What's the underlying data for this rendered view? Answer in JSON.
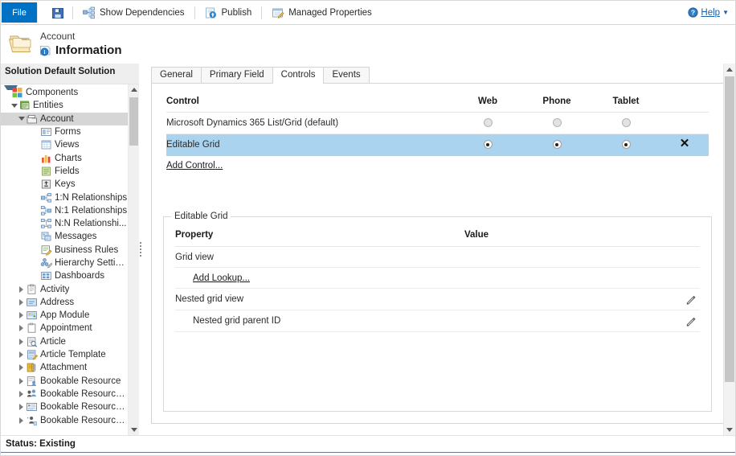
{
  "ribbon": {
    "file_label": "File",
    "save_icon": "save-icon",
    "items": [
      {
        "label": "Show Dependencies",
        "icon": "dependencies-icon"
      },
      {
        "label": "Publish",
        "icon": "publish-icon"
      },
      {
        "label": "Managed Properties",
        "icon": "managed-properties-icon"
      }
    ],
    "help_label": "Help",
    "help_icon": "help-icon"
  },
  "header": {
    "entity_label": "Account",
    "page_title": "Information",
    "folder_icon": "folder-icon",
    "info_icon": "information-icon"
  },
  "sidebar": {
    "solution_header": "Solution Default Solution",
    "tree": [
      {
        "label": "Components",
        "depth": 0,
        "arrow": "none",
        "icon": "components-icon",
        "selected": false
      },
      {
        "label": "Entities",
        "depth": 1,
        "arrow": "expanded",
        "icon": "entities-icon",
        "selected": false
      },
      {
        "label": "Account",
        "depth": 2,
        "arrow": "expanded",
        "icon": "entity-icon",
        "selected": true
      },
      {
        "label": "Forms",
        "depth": 4,
        "arrow": "none",
        "icon": "forms-icon",
        "selected": false
      },
      {
        "label": "Views",
        "depth": 4,
        "arrow": "none",
        "icon": "views-icon",
        "selected": false
      },
      {
        "label": "Charts",
        "depth": 4,
        "arrow": "none",
        "icon": "charts-icon",
        "selected": false
      },
      {
        "label": "Fields",
        "depth": 4,
        "arrow": "none",
        "icon": "fields-icon",
        "selected": false
      },
      {
        "label": "Keys",
        "depth": 4,
        "arrow": "none",
        "icon": "keys-icon",
        "selected": false
      },
      {
        "label": "1:N Relationships",
        "depth": 4,
        "arrow": "none",
        "icon": "one-to-many-icon",
        "selected": false
      },
      {
        "label": "N:1 Relationships",
        "depth": 4,
        "arrow": "none",
        "icon": "many-to-one-icon",
        "selected": false
      },
      {
        "label": "N:N Relationshi...",
        "depth": 4,
        "arrow": "none",
        "icon": "many-to-many-icon",
        "selected": false
      },
      {
        "label": "Messages",
        "depth": 4,
        "arrow": "none",
        "icon": "messages-icon",
        "selected": false
      },
      {
        "label": "Business Rules",
        "depth": 4,
        "arrow": "none",
        "icon": "business-rules-icon",
        "selected": false
      },
      {
        "label": "Hierarchy Settin...",
        "depth": 4,
        "arrow": "none",
        "icon": "hierarchy-settings-icon",
        "selected": false
      },
      {
        "label": "Dashboards",
        "depth": 4,
        "arrow": "none",
        "icon": "dashboards-icon",
        "selected": false
      },
      {
        "label": "Activity",
        "depth": 2,
        "arrow": "collapsed",
        "icon": "activity-icon",
        "selected": false
      },
      {
        "label": "Address",
        "depth": 2,
        "arrow": "collapsed",
        "icon": "address-icon",
        "selected": false
      },
      {
        "label": "App Module",
        "depth": 2,
        "arrow": "collapsed",
        "icon": "app-module-icon",
        "selected": false
      },
      {
        "label": "Appointment",
        "depth": 2,
        "arrow": "collapsed",
        "icon": "appointment-icon",
        "selected": false
      },
      {
        "label": "Article",
        "depth": 2,
        "arrow": "collapsed",
        "icon": "article-icon",
        "selected": false
      },
      {
        "label": "Article Template",
        "depth": 2,
        "arrow": "collapsed",
        "icon": "article-template-icon",
        "selected": false
      },
      {
        "label": "Attachment",
        "depth": 2,
        "arrow": "collapsed",
        "icon": "attachment-icon",
        "selected": false
      },
      {
        "label": "Bookable Resource",
        "depth": 2,
        "arrow": "collapsed",
        "icon": "bookable-resource-icon",
        "selected": false
      },
      {
        "label": "Bookable Resource ...",
        "depth": 2,
        "arrow": "collapsed",
        "icon": "bookable-resource-group-icon",
        "selected": false
      },
      {
        "label": "Bookable Resource ...",
        "depth": 2,
        "arrow": "collapsed",
        "icon": "bookable-resource-booking-icon",
        "selected": false
      },
      {
        "label": "Bookable Resource ...",
        "depth": 2,
        "arrow": "collapsed",
        "icon": "bookable-resource-category-icon",
        "selected": false
      }
    ]
  },
  "main": {
    "tabs": [
      {
        "label": "General",
        "active": false
      },
      {
        "label": "Primary Field",
        "active": false
      },
      {
        "label": "Controls",
        "active": true
      },
      {
        "label": "Events",
        "active": false
      }
    ],
    "controls_table": {
      "headers": [
        "Control",
        "Web",
        "Phone",
        "Tablet",
        ""
      ],
      "rows": [
        {
          "control": "Microsoft Dynamics 365 List/Grid (default)",
          "web": "off",
          "phone": "off",
          "tablet": "off",
          "remove": "",
          "selected": false
        },
        {
          "control": "Editable Grid",
          "web": "on",
          "phone": "on",
          "tablet": "on",
          "remove": "✕",
          "selected": true
        }
      ]
    },
    "add_control_label": "Add Control...",
    "properties_group": {
      "legend": "Editable Grid",
      "headers": [
        "Property",
        "Value",
        ""
      ],
      "rows": [
        {
          "property": "Grid view",
          "value": "",
          "indent": false,
          "link": false,
          "edit": false
        },
        {
          "property": "Add Lookup...",
          "value": "",
          "indent": true,
          "link": true,
          "edit": false
        },
        {
          "property": "Nested grid view",
          "value": "",
          "indent": false,
          "link": false,
          "edit": true
        },
        {
          "property": "Nested grid parent ID",
          "value": "",
          "indent": true,
          "link": false,
          "edit": true
        }
      ]
    }
  },
  "status": {
    "text": "Status: Existing"
  },
  "colors": {
    "accent": "#0072c6",
    "selected_row": "#a9d3ef",
    "header_bg": "#eeeeee",
    "link": "#1b5faa"
  }
}
